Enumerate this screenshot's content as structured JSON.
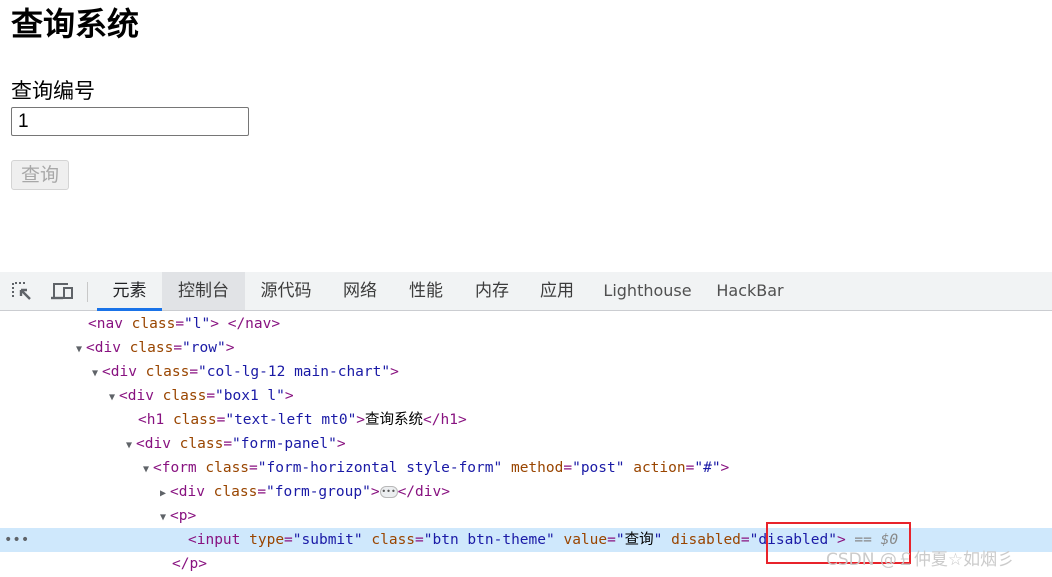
{
  "page": {
    "title": "查询系统",
    "field_label": "查询编号",
    "field_value": "1",
    "submit_label": "查询",
    "submit_disabled": true
  },
  "devtools": {
    "toolbar_icons": [
      "inspect-element-icon",
      "device-toolbar-icon"
    ],
    "tabs": [
      {
        "label": "元素",
        "active": true
      },
      {
        "label": "控制台",
        "active": false,
        "hover": true
      },
      {
        "label": "源代码",
        "active": false
      },
      {
        "label": "网络",
        "active": false
      },
      {
        "label": "性能",
        "active": false
      },
      {
        "label": "内存",
        "active": false
      },
      {
        "label": "应用",
        "active": false
      },
      {
        "label": "Lighthouse",
        "active": false
      },
      {
        "label": "HackBar",
        "active": false
      }
    ],
    "dom_lines": [
      {
        "tag_open": "<nav",
        "attrs": [
          {
            "name": "class",
            "value": "l"
          }
        ],
        "tail": "> </nav>"
      },
      {
        "tag_open": "<div",
        "attrs": [
          {
            "name": "class",
            "value": "row"
          }
        ],
        "tail": ">"
      },
      {
        "tag_open": "<div",
        "attrs": [
          {
            "name": "class",
            "value": "col-lg-12 main-chart"
          }
        ],
        "tail": ">"
      },
      {
        "tag_open": "<div",
        "attrs": [
          {
            "name": "class",
            "value": "box1 l"
          }
        ],
        "tail": ">"
      },
      {
        "tag_open": "<h1",
        "attrs": [
          {
            "name": "class",
            "value": "text-left mt0"
          }
        ],
        "tail": ">",
        "text": "查询系统",
        "close": "</h1>"
      },
      {
        "tag_open": "<div",
        "attrs": [
          {
            "name": "class",
            "value": "form-panel"
          }
        ],
        "tail": ">"
      },
      {
        "tag_open": "<form",
        "attrs": [
          {
            "name": "class",
            "value": "form-horizontal style-form"
          },
          {
            "name": "method",
            "value": "post"
          },
          {
            "name": "action",
            "value": "#"
          }
        ],
        "tail": ">"
      },
      {
        "tag_open": "<div",
        "attrs": [
          {
            "name": "class",
            "value": "form-group"
          }
        ],
        "tail": ">",
        "close": "</div>"
      },
      {
        "tag_open": "<p",
        "tail": ">"
      },
      {
        "tag_open": "<input",
        "attrs": [
          {
            "name": "type",
            "value": "submit"
          },
          {
            "name": "class",
            "value": "btn btn-theme"
          },
          {
            "name": "value",
            "value": "查询"
          },
          {
            "name": "disabled",
            "value": "disabled"
          }
        ],
        "tail": ">",
        "selected_marker": "== $0"
      },
      {
        "close": "</p>"
      }
    ]
  },
  "watermark": "CSDN @￡仲夏☆如烟彡",
  "colors": {
    "selected_row": "#cfe8fc",
    "active_tab_underline": "#1a73e8",
    "highlight_box": "#e8232b",
    "tag": "#881280",
    "attr_name": "#994500",
    "attr_value": "#1a1aa6"
  }
}
